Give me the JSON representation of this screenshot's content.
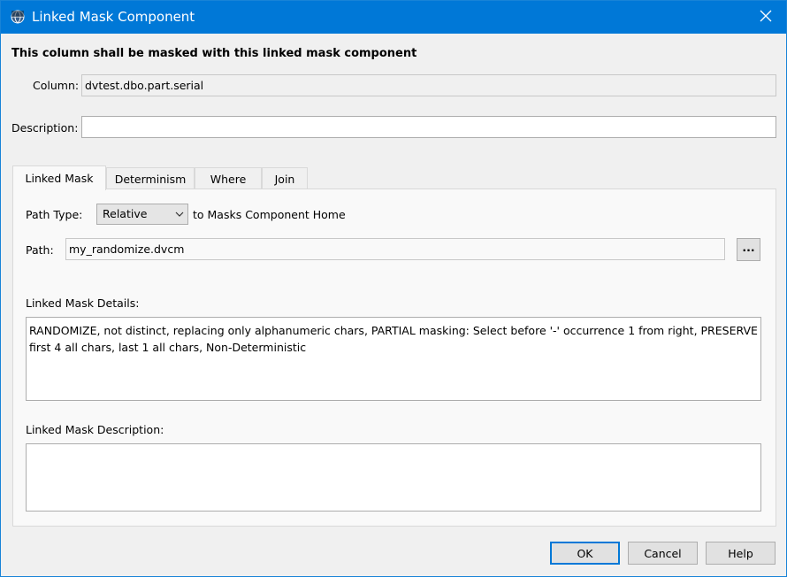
{
  "window": {
    "title": "Linked Mask Component",
    "title_icon": "app-globe-icon",
    "close_icon": "close-icon"
  },
  "heading": "This column shall be masked with this linked mask component",
  "column": {
    "label": "Column:",
    "value": "dvtest.dbo.part.serial"
  },
  "description": {
    "label": "Description:",
    "value": ""
  },
  "tabs": [
    {
      "label": "Linked Mask",
      "active": true
    },
    {
      "label": "Determinism",
      "active": false
    },
    {
      "label": "Where",
      "active": false
    },
    {
      "label": "Join",
      "active": false
    }
  ],
  "linked_mask": {
    "path_type_label": "Path Type:",
    "path_type_value": "Relative",
    "path_type_suffix": "to Masks Component Home",
    "path_label": "Path:",
    "path_value": "my_randomize.dvcm",
    "browse_label": "...",
    "details_label": "Linked Mask Details:",
    "details_value": "RANDOMIZE, not distinct, replacing only alphanumeric chars, PARTIAL masking: Select before '-' occurrence 1 from right, PRESERVE first 4 all chars, last 1 all chars, Non-Deterministic",
    "description_label": "Linked Mask Description:",
    "description_value": ""
  },
  "buttons": {
    "ok": "OK",
    "cancel": "Cancel",
    "help": "Help"
  },
  "colors": {
    "titlebar": "#0078d7",
    "dialog_bg": "#f0f0f0",
    "panel_bg": "#f9f9f9",
    "default_button_border": "#0078d7"
  }
}
